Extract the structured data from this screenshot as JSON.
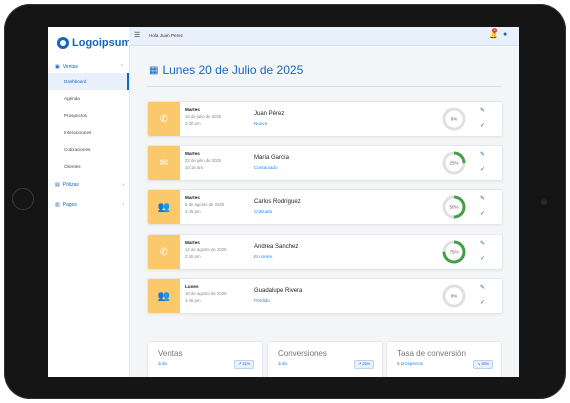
{
  "app": {
    "logo_text": "Logoipsum",
    "greeting": "Hola Juan Perez",
    "notification_count": "3"
  },
  "sidebar": {
    "groups": [
      {
        "label": "Ventas",
        "icon": "sales-icon",
        "items": [
          "Dashboard",
          "Agenda",
          "Prospectos",
          "Interacciones",
          "Cotizaciones",
          "Clientes"
        ],
        "active": "Dashboard"
      },
      {
        "label": "Pólizas",
        "icon": "policy-icon"
      },
      {
        "label": "Pagos",
        "icon": "payments-icon"
      }
    ]
  },
  "page": {
    "title": "Lunes 20 de Julio de 2025",
    "title_icon": "calendar-icon"
  },
  "appointments": [
    {
      "type_icon": "phone-icon",
      "glyph": "✆",
      "day": "Martes",
      "date": "15 de julio de 2025",
      "time": "3:30 pm",
      "name": "Juan Pérez",
      "status": "Nuevo",
      "progress": 0,
      "progress_label": "0%"
    },
    {
      "type_icon": "email-icon",
      "glyph": "✉",
      "day": "Martes",
      "date": "22 de julio de 2025",
      "time": "10:15 am",
      "name": "María García",
      "status": "Contactado",
      "progress": 25,
      "progress_label": "25%"
    },
    {
      "type_icon": "group-icon",
      "glyph": "👥",
      "day": "Martes",
      "date": "5 de agosto de 2025",
      "time": "4:45 pm",
      "name": "Carlos Rodríguez",
      "status": "Cotizado",
      "progress": 50,
      "progress_label": "50%"
    },
    {
      "type_icon": "whatsapp-icon",
      "glyph": "✆",
      "day": "Martes",
      "date": "12 de agosto de 2025",
      "time": "2:45 pm",
      "name": "Andrea Sanchez",
      "status": "En cierre",
      "progress": 75,
      "progress_label": "75%"
    },
    {
      "type_icon": "group-icon",
      "glyph": "👥",
      "day": "Lunes",
      "date": "18 de agosto de 2025",
      "time": "4:45 pm",
      "name": "Guadalupe Rivera",
      "status": "Perdido",
      "progress": 0,
      "progress_label": "0%"
    }
  ],
  "stats": [
    {
      "title": "Ventas",
      "subtitle": "Julio",
      "badge": "↗ 31%"
    },
    {
      "title": "Conversiones",
      "subtitle": "Julio",
      "badge": "↗ 26%"
    },
    {
      "title": "Tasa de conversión",
      "subtitle": "5 prospectos",
      "badge": "↘ 35%"
    }
  ],
  "colors": {
    "brand": "#1565c0",
    "accent_yellow": "#fbc96b",
    "progress_green": "#43a047",
    "ring_track": "#e0e0e0"
  }
}
